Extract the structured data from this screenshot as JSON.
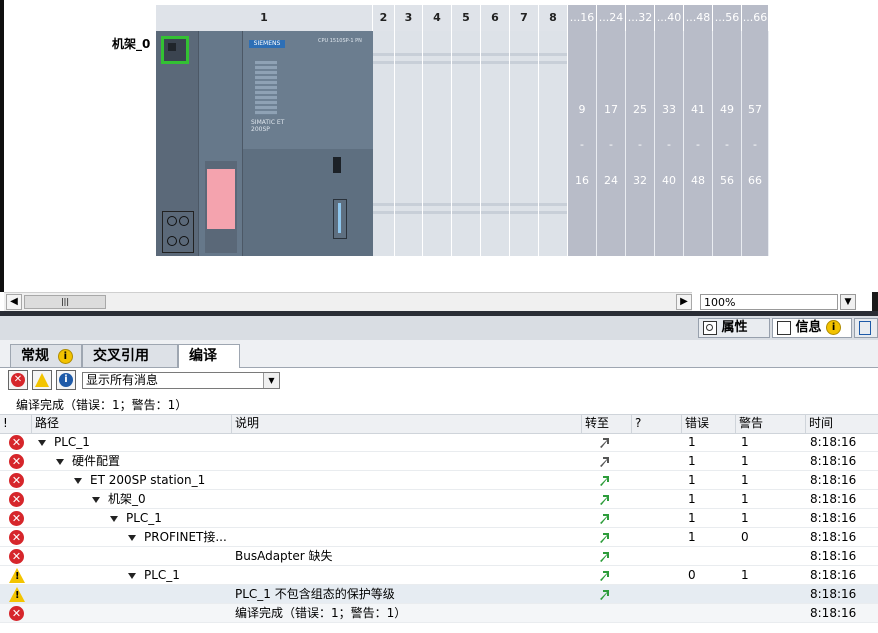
{
  "device": {
    "rack_label": "机架_0",
    "slot_headers": [
      "1",
      "2",
      "3",
      "4",
      "5",
      "6",
      "7",
      "8",
      "...16",
      "...24",
      "...32",
      "...40",
      "...48",
      "...56",
      "...66"
    ],
    "range_starts": [
      "9",
      "17",
      "25",
      "33",
      "41",
      "49",
      "57"
    ],
    "range_dash": "-",
    "range_ends": [
      "16",
      "24",
      "32",
      "40",
      "48",
      "56",
      "66"
    ],
    "module_brand": "SIEMENS",
    "module_name": "SIMATIC ET 200SP",
    "module_cpu_label": "CPU 1510SP-1 PN"
  },
  "scroll": {
    "zoom_value": "100%",
    "thumb_glyph": "|||"
  },
  "inspector": {
    "tabs": [
      {
        "label": "属性",
        "icon": "properties-icon"
      },
      {
        "label": "信息",
        "icon": "info-icon"
      }
    ]
  },
  "info": {
    "subtabs": [
      "常规",
      "交叉引用",
      "编译"
    ],
    "active_subtab": "编译",
    "filter_value": "显示所有消息",
    "summary": "编译完成（错误：1；警告：1）"
  },
  "table": {
    "columns": [
      "!",
      "路径",
      "说明",
      "转至",
      "?",
      "错误",
      "警告",
      "时间"
    ],
    "rows": [
      {
        "status": "error",
        "indent": 0,
        "expand": true,
        "path": "PLC_1",
        "desc": "",
        "goto": "gray",
        "errors": "1",
        "warnings": "1",
        "time": "8:18:16"
      },
      {
        "status": "error",
        "indent": 1,
        "expand": true,
        "path": "硬件配置",
        "desc": "",
        "goto": "gray",
        "errors": "1",
        "warnings": "1",
        "time": "8:18:16"
      },
      {
        "status": "error",
        "indent": 2,
        "expand": true,
        "path": "ET 200SP station_1",
        "desc": "",
        "goto": "green",
        "errors": "1",
        "warnings": "1",
        "time": "8:18:16"
      },
      {
        "status": "error",
        "indent": 3,
        "expand": true,
        "path": "机架_0",
        "desc": "",
        "goto": "green",
        "errors": "1",
        "warnings": "1",
        "time": "8:18:16"
      },
      {
        "status": "error",
        "indent": 4,
        "expand": true,
        "path": "PLC_1",
        "desc": "",
        "goto": "green",
        "errors": "1",
        "warnings": "1",
        "time": "8:18:16"
      },
      {
        "status": "error",
        "indent": 5,
        "expand": true,
        "path": "PROFINET接...",
        "desc": "",
        "goto": "green",
        "errors": "1",
        "warnings": "0",
        "time": "8:18:16"
      },
      {
        "status": "error",
        "indent": 6,
        "expand": false,
        "path": "",
        "desc": "BusAdapter 缺失",
        "goto": "green",
        "errors": "",
        "warnings": "",
        "time": "8:18:16"
      },
      {
        "status": "warning",
        "indent": 5,
        "expand": true,
        "path": "PLC_1",
        "desc": "",
        "goto": "green",
        "errors": "0",
        "warnings": "1",
        "time": "8:18:16"
      },
      {
        "status": "warning",
        "indent": 6,
        "expand": false,
        "path": "",
        "desc": "PLC_1 不包含组态的保护等级",
        "goto": "green",
        "errors": "",
        "warnings": "",
        "time": "8:18:16",
        "selected": true
      },
      {
        "status": "error",
        "indent": 0,
        "expand": false,
        "path": "",
        "desc": "编译完成（错误：1；警告：1）",
        "goto": "",
        "errors": "",
        "warnings": "",
        "time": "8:18:16",
        "alt": true
      }
    ]
  },
  "colors": {
    "error": "#d6262b",
    "warning": "#f3c400",
    "goto_green": "#2c9c3a",
    "slot_gray": "#b8bcc8",
    "module": "#5d6b7b"
  }
}
